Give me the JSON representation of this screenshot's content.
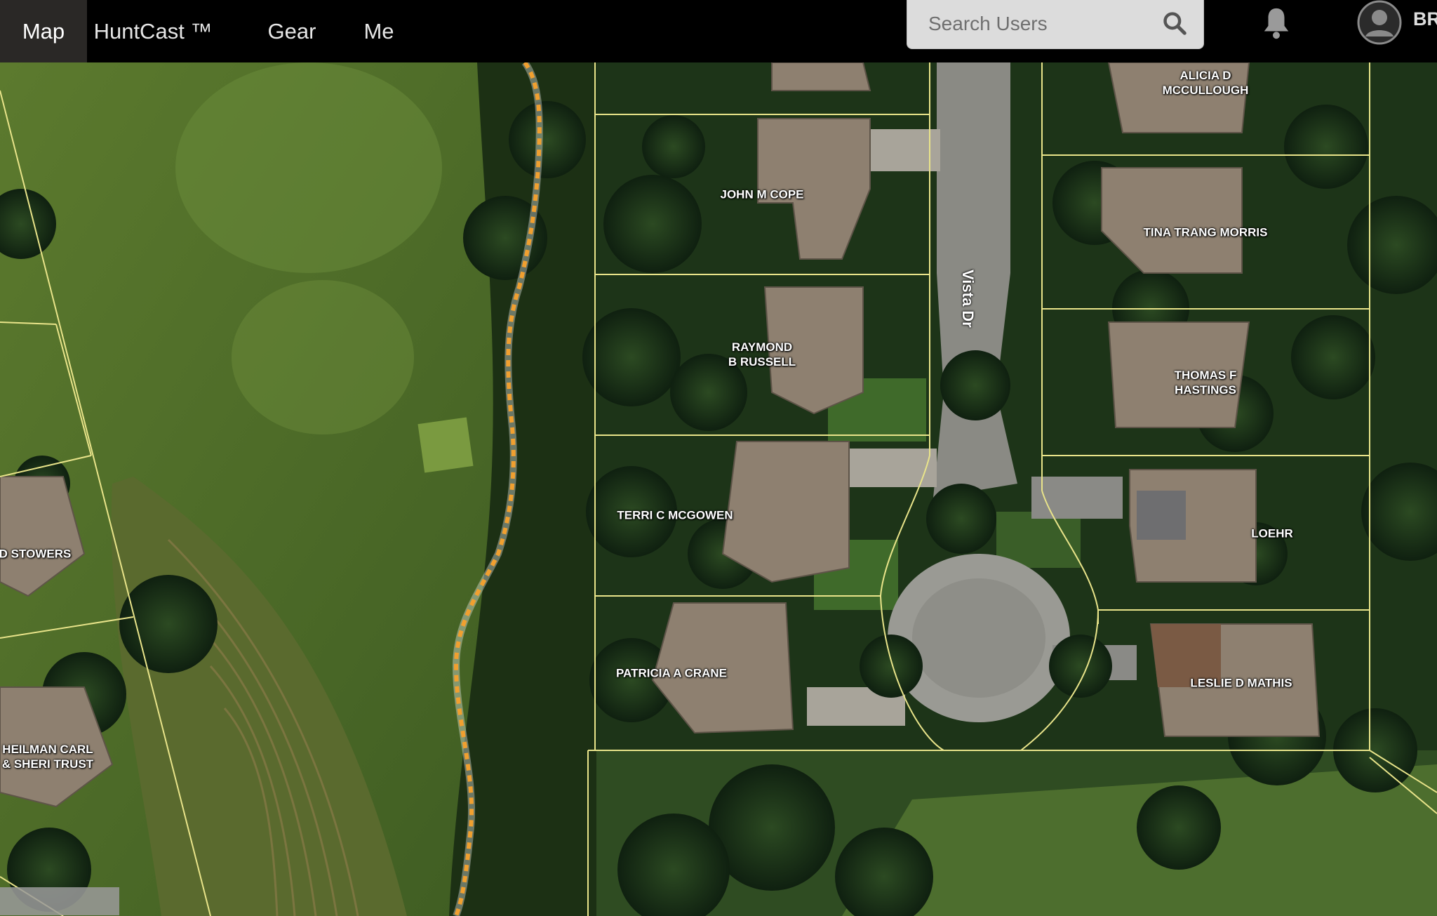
{
  "nav": {
    "tabs": [
      {
        "label": "Map",
        "active": true
      },
      {
        "label": "HuntCast ™",
        "active": false
      },
      {
        "label": "Gear",
        "active": false
      },
      {
        "label": "Me",
        "active": false
      }
    ]
  },
  "search": {
    "placeholder": "Search Users",
    "icon": "search-icon"
  },
  "notifications": {
    "icon": "bell-icon"
  },
  "user": {
    "icon": "avatar-icon",
    "name_partial": "BR"
  },
  "map": {
    "street": "Vista Dr",
    "parcels": [
      {
        "label": "ALICIA D\nMCCULLOUGH"
      },
      {
        "label": "JOHN M COPE"
      },
      {
        "label": "TINA TRANG MORRIS"
      },
      {
        "label": "RAYMOND\nB RUSSELL"
      },
      {
        "label": "THOMAS F\nHASTINGS"
      },
      {
        "label": "TERRI C MCGOWEN"
      },
      {
        "label": "LOEHR"
      },
      {
        "label": "D STOWERS"
      },
      {
        "label": "PATRICIA A CRANE"
      },
      {
        "label": "LESLIE D MATHIS"
      },
      {
        "label": "HEILMAN CARL\n& SHERI TRUST"
      }
    ],
    "colors": {
      "parcel_line": "#e9e48a",
      "trail": "#f0a030",
      "grass": "#4e6a2a",
      "trees": "#1f3818"
    }
  }
}
